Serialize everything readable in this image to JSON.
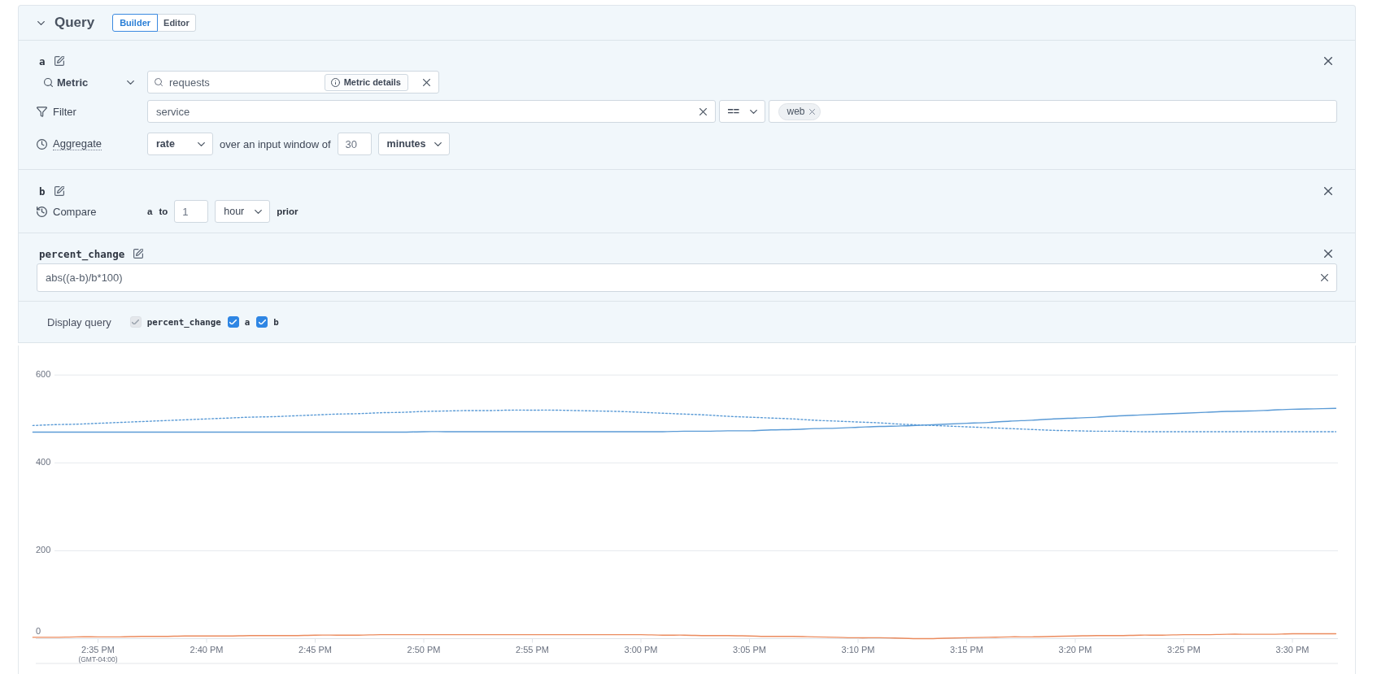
{
  "header": {
    "expanded": true,
    "title": "Query",
    "modes": [
      {
        "label": "Builder",
        "selected": true
      },
      {
        "label": "Editor",
        "selected": false
      }
    ]
  },
  "queries": [
    {
      "kind": "metric",
      "name": "a",
      "metric": {
        "type_label": "Metric",
        "value": "requests",
        "details_button": "Metric details"
      },
      "filter": {
        "label": "Filter",
        "key": "service",
        "operator": "==",
        "values": [
          "web"
        ]
      },
      "aggregate": {
        "label": "Aggregate",
        "function": "rate",
        "text": "over an input window of",
        "window": "30",
        "unit": "minutes"
      }
    },
    {
      "kind": "compare",
      "name": "b",
      "compare": {
        "label": "Compare",
        "query": "a",
        "to": "to",
        "amount": "1",
        "unit": "hour",
        "suffix": "prior"
      }
    },
    {
      "kind": "expression",
      "name": "percent_change",
      "expression": "abs((a-b)/b*100)"
    }
  ],
  "display_query": {
    "label": "Display query",
    "items": [
      {
        "label": "percent_change",
        "checked": true,
        "disabled": true
      },
      {
        "label": "a",
        "checked": true,
        "disabled": false
      },
      {
        "label": "b",
        "checked": true,
        "disabled": false
      }
    ]
  },
  "chart": {
    "timezone": "(GMT-04:00)",
    "chart_data": {
      "type": "line",
      "grid": true,
      "categories": [
        null,
        null,
        null,
        "2:35 PM",
        null,
        null,
        null,
        null,
        "2:40 PM",
        null,
        null,
        null,
        null,
        "2:45 PM",
        null,
        null,
        null,
        null,
        "2:50 PM",
        null,
        null,
        null,
        null,
        "2:55 PM",
        null,
        null,
        null,
        null,
        "3:00 PM",
        null,
        null,
        null,
        null,
        "3:05 PM",
        null,
        null,
        null,
        null,
        "3:10 PM",
        null,
        null,
        null,
        null,
        "3:15 PM",
        null,
        null,
        null,
        null,
        "3:20 PM",
        null,
        null,
        null,
        null,
        "3:25 PM",
        null,
        null,
        null,
        null,
        "3:30 PM",
        null,
        null
      ],
      "series": [
        {
          "color": "#5b9bd6",
          "line_style": "solid",
          "values": [
            470,
            470,
            470,
            470,
            470,
            470,
            470,
            470,
            470,
            470,
            470,
            470,
            470,
            470,
            470,
            470,
            470,
            470,
            471,
            471,
            471,
            471,
            471,
            471,
            471,
            471,
            471,
            471,
            471,
            471,
            472,
            472,
            473,
            473,
            475,
            476,
            478,
            479,
            481,
            483,
            484,
            486,
            488,
            490,
            492,
            495,
            497,
            500,
            502,
            504,
            507,
            509,
            511,
            513,
            515,
            517,
            518,
            520,
            522,
            523,
            524
          ]
        },
        {
          "color": "#5b9bd6",
          "line_style": "dotted",
          "values": [
            485,
            487,
            488,
            490,
            492,
            494,
            496,
            498,
            500,
            502,
            504,
            505,
            507,
            509,
            511,
            512,
            514,
            515,
            517,
            518,
            519,
            519,
            520,
            520,
            520,
            519,
            518,
            517,
            515,
            513,
            511,
            509,
            506,
            504,
            502,
            500,
            497,
            495,
            493,
            491,
            488,
            486,
            484,
            482,
            480,
            478,
            476,
            474,
            473,
            472,
            472,
            471,
            471,
            471,
            471,
            471,
            471,
            471,
            471,
            471,
            471
          ]
        },
        {
          "color": "#eb8b5e",
          "line_style": "solid",
          "values": [
            3,
            3,
            4,
            4,
            4,
            5,
            5,
            6,
            6,
            6,
            7,
            7,
            7,
            8,
            8,
            8,
            9,
            9,
            9,
            9,
            9,
            9,
            9,
            9,
            9,
            9,
            9,
            9,
            9,
            8,
            8,
            7,
            7,
            6,
            5,
            5,
            4,
            3,
            2,
            2,
            1,
            0,
            1,
            2,
            3,
            4,
            4,
            5,
            6,
            7,
            7,
            8,
            8,
            9,
            9,
            10,
            10,
            10,
            11,
            11,
            11
          ]
        }
      ],
      "ylim": [
        0,
        667
      ],
      "yticks": [
        0,
        200,
        400,
        600
      ]
    }
  }
}
